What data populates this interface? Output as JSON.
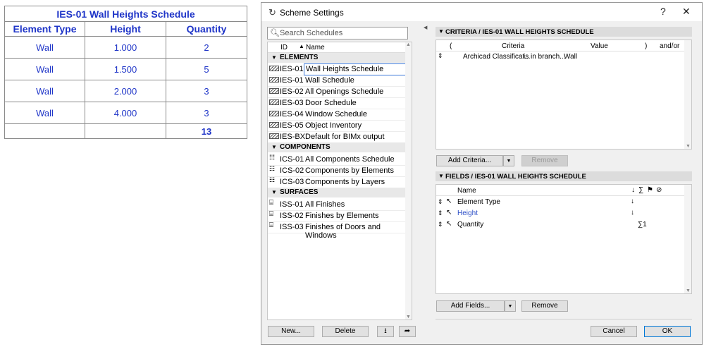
{
  "schedule": {
    "title": "IES-01 Wall Heights Schedule",
    "headers": [
      "Element Type",
      "Height",
      "Quantity"
    ],
    "rows": [
      [
        "Wall",
        "1.000",
        "2"
      ],
      [
        "Wall",
        "1.500",
        "5"
      ],
      [
        "Wall",
        "2.000",
        "3"
      ],
      [
        "Wall",
        "4.000",
        "3"
      ]
    ],
    "total": "13"
  },
  "dialog": {
    "title": "Scheme Settings",
    "help": "?",
    "close": "✕",
    "search_placeholder": "Search Schedules",
    "list_headers": {
      "id": "ID",
      "name": "Name"
    },
    "groups": {
      "elements": "ELEMENTS",
      "components": "COMPONENTS",
      "surfaces": "SURFACES"
    },
    "elements": [
      {
        "id": "IES-01",
        "name": "Wall Heights Schedule"
      },
      {
        "id": "IES-01",
        "name": "Wall Schedule"
      },
      {
        "id": "IES-02",
        "name": "All Openings Schedule"
      },
      {
        "id": "IES-03",
        "name": "Door Schedule"
      },
      {
        "id": "IES-04",
        "name": "Window Schedule"
      },
      {
        "id": "IES-05",
        "name": "Object Inventory"
      },
      {
        "id": "IES-BX",
        "name": "Default for BIMx output"
      }
    ],
    "components": [
      {
        "id": "ICS-01",
        "name": "All Components Schedule"
      },
      {
        "id": "ICS-02",
        "name": "Components by Elements"
      },
      {
        "id": "ICS-03",
        "name": "Components by Layers"
      }
    ],
    "surfaces": [
      {
        "id": "ISS-01",
        "name": "All Finishes"
      },
      {
        "id": "ISS-02",
        "name": "Finishes by Elements"
      },
      {
        "id": "ISS-03",
        "name": "Finishes of Doors and Windows"
      }
    ],
    "left_buttons": {
      "new": "New...",
      "delete": "Delete"
    },
    "criteria": {
      "title": "CRITERIA / IES-01 WALL HEIGHTS SCHEDULE",
      "columns": {
        "open": "(",
        "criteria": "Criteria",
        "value": "Value",
        "close": ")",
        "andor": "and/or"
      },
      "row": {
        "criteria": "Archicad Classificat...",
        "operator": "is in branch...",
        "value": "Wall"
      },
      "add_label": "Add Criteria...",
      "remove_label": "Remove"
    },
    "fields": {
      "title": "FIELDS / IES-01 WALL HEIGHTS SCHEDULE",
      "name_header": "Name",
      "sum_header": "∑",
      "rows": [
        {
          "name": "Element Type",
          "sort": "↓",
          "sum": ""
        },
        {
          "name": "Height",
          "sort": "↓",
          "sum": ""
        },
        {
          "name": "Quantity",
          "sort": "",
          "sum": "∑1"
        }
      ],
      "add_label": "Add Fields...",
      "remove_label": "Remove"
    },
    "cancel": "Cancel",
    "ok": "OK"
  }
}
